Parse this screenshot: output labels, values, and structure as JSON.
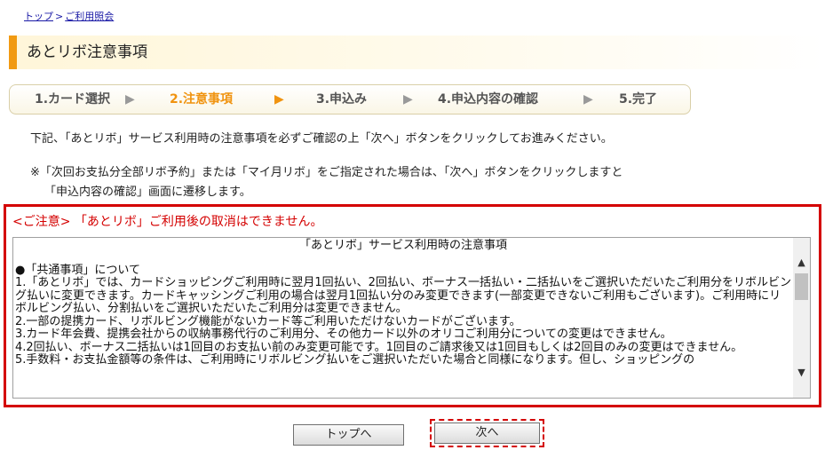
{
  "breadcrumb": {
    "top": "トップ",
    "separator": ">",
    "current": "ご利用照会"
  },
  "page_title": "あとリボ注意事項",
  "steps": [
    {
      "label": "1.カード選択"
    },
    {
      "label": "2.注意事項"
    },
    {
      "label": "3.申込み"
    },
    {
      "label": "4.申込内容の確認"
    },
    {
      "label": "5.完了"
    }
  ],
  "step_arrow": "▶",
  "intro": "下記、「あとリボ」サービス利用時の注意事項を必ずご確認の上「次へ」ボタンをクリックしてお進みください。",
  "note_line1": "※「次回お支払分全部リボ予約」または「マイ月リボ」をご指定された場合は、「次へ」ボタンをクリックしますと",
  "note_line2": "「申込内容の確認」画面に遷移します。",
  "warning": "<ご注意> 「あとリボ」ご利用後の取消はできません。",
  "terms": {
    "title": "「あとリボ」サービス利用時の注意事項",
    "section": "●「共通事項」について",
    "items": [
      "1.「あとリボ」では、カードショッピングご利用時に翌月1回払い、2回払い、ボーナス一括払い・二括払いをご選択いただいたご利用分をリボルビング払いに変更できます。カードキャッシングご利用の場合は翌月1回払い分のみ変更できます(一部変更できないご利用もございます)。ご利用時にリボルビング払い、分割払いをご選択いただいたご利用分は変更できません。",
      "2.一部の提携カード、リボルビング機能がないカード等ご利用いただけないカードがございます。",
      "3.カード年会費、提携会社からの収納事務代行のご利用分、その他カード以外のオリコご利用分についての変更はできません。",
      "4.2回払い、ボーナス二括払いは1回目のお支払い前のみ変更可能です。1回目のご請求後又は1回目もしくは2回目のみの変更はできません。",
      "5.手数料・お支払金額等の条件は、ご利用時にリボルビング払いをご選択いただいた場合と同様になります。但し、ショッピングの"
    ]
  },
  "scroll": {
    "up": "▲",
    "down": "▼"
  },
  "buttons": {
    "top": "トップへ",
    "next": "次へ"
  },
  "colors": {
    "accent": "#f19a12",
    "warning": "#d40000",
    "step_active": "#f0930f"
  }
}
